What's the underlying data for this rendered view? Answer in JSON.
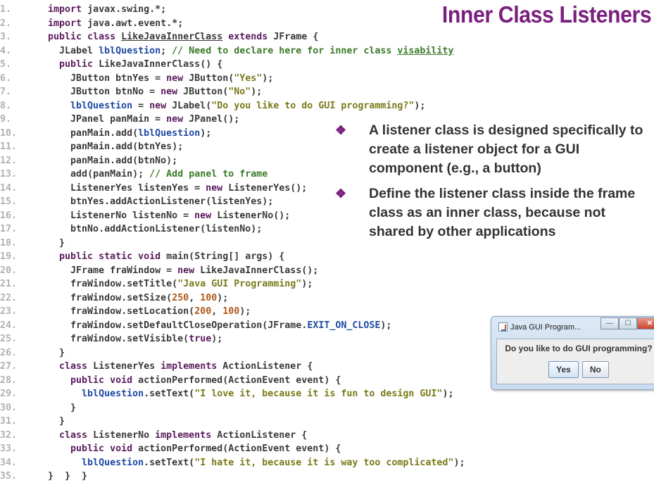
{
  "title": "Inner Class Listeners",
  "code_lines": [
    {
      "n": "1.",
      "indent": 1,
      "segs": [
        [
          "k",
          "import"
        ],
        [
          "p",
          " javax"
        ],
        [
          "o",
          "."
        ],
        [
          "p",
          "swing"
        ],
        [
          "o",
          ".*;"
        ]
      ]
    },
    {
      "n": "2.",
      "indent": 1,
      "segs": [
        [
          "k",
          "import"
        ],
        [
          "p",
          " java"
        ],
        [
          "o",
          "."
        ],
        [
          "p",
          "awt"
        ],
        [
          "o",
          "."
        ],
        [
          "p",
          "event"
        ],
        [
          "o",
          ".*;"
        ]
      ]
    },
    {
      "n": "3.",
      "indent": 1,
      "segs": [
        [
          "k",
          "public class "
        ],
        [
          "pu",
          "LikeJavaInnerClass"
        ],
        [
          "k",
          " extends "
        ],
        [
          "p",
          "JFrame "
        ],
        [
          "o",
          "{"
        ]
      ]
    },
    {
      "n": "4.",
      "indent": 2,
      "segs": [
        [
          "p",
          "JLabel "
        ],
        [
          "f",
          "lblQuestion"
        ],
        [
          "o",
          "; "
        ],
        [
          "c",
          "// Need to declare here for inner class "
        ],
        [
          "cu",
          "visability"
        ]
      ]
    },
    {
      "n": "5.",
      "indent": 2,
      "segs": [
        [
          "k",
          "public "
        ],
        [
          "p",
          "LikeJavaInnerClass"
        ],
        [
          "o",
          "() {"
        ]
      ]
    },
    {
      "n": "6.",
      "indent": 3,
      "segs": [
        [
          "p",
          "JButton btnYes "
        ],
        [
          "o",
          "= "
        ],
        [
          "k",
          "new "
        ],
        [
          "p",
          "JButton"
        ],
        [
          "o",
          "("
        ],
        [
          "s",
          "\"Yes\""
        ],
        [
          "o",
          ");"
        ]
      ]
    },
    {
      "n": "7.",
      "indent": 3,
      "segs": [
        [
          "p",
          "JButton btnNo "
        ],
        [
          "o",
          "= "
        ],
        [
          "k",
          "new "
        ],
        [
          "p",
          "JButton"
        ],
        [
          "o",
          "("
        ],
        [
          "s",
          "\"No\""
        ],
        [
          "o",
          ");"
        ]
      ]
    },
    {
      "n": "8.",
      "indent": 3,
      "segs": [
        [
          "f",
          "lblQuestion "
        ],
        [
          "o",
          "= "
        ],
        [
          "k",
          "new "
        ],
        [
          "p",
          "JLabel"
        ],
        [
          "o",
          "("
        ],
        [
          "s",
          "\"Do you like to do GUI programming?\""
        ],
        [
          "o",
          ");"
        ]
      ]
    },
    {
      "n": "9.",
      "indent": 3,
      "segs": [
        [
          "p",
          "JPanel panMain "
        ],
        [
          "o",
          "= "
        ],
        [
          "k",
          "new "
        ],
        [
          "p",
          "JPanel"
        ],
        [
          "o",
          "();"
        ]
      ]
    },
    {
      "n": "10.",
      "indent": 3,
      "segs": [
        [
          "p",
          "panMain"
        ],
        [
          "o",
          "."
        ],
        [
          "p",
          "add"
        ],
        [
          "o",
          "("
        ],
        [
          "f",
          "lblQuestion"
        ],
        [
          "o",
          ");"
        ]
      ]
    },
    {
      "n": "11.",
      "indent": 3,
      "segs": [
        [
          "p",
          "panMain"
        ],
        [
          "o",
          "."
        ],
        [
          "p",
          "add"
        ],
        [
          "o",
          "("
        ],
        [
          "p",
          "btnYes"
        ],
        [
          "o",
          ");"
        ]
      ]
    },
    {
      "n": "12.",
      "indent": 3,
      "segs": [
        [
          "p",
          "panMain"
        ],
        [
          "o",
          "."
        ],
        [
          "p",
          "add"
        ],
        [
          "o",
          "("
        ],
        [
          "p",
          "btnNo"
        ],
        [
          "o",
          ");"
        ]
      ]
    },
    {
      "n": "13.",
      "indent": 3,
      "segs": [
        [
          "p",
          "add"
        ],
        [
          "o",
          "("
        ],
        [
          "p",
          "panMain"
        ],
        [
          "o",
          "); "
        ],
        [
          "c",
          "// Add panel to frame"
        ]
      ]
    },
    {
      "n": "14.",
      "indent": 3,
      "segs": [
        [
          "p",
          "ListenerYes listenYes "
        ],
        [
          "o",
          "= "
        ],
        [
          "k",
          "new "
        ],
        [
          "p",
          "ListenerYes"
        ],
        [
          "o",
          "();"
        ]
      ]
    },
    {
      "n": "15.",
      "indent": 3,
      "segs": [
        [
          "p",
          "btnYes"
        ],
        [
          "o",
          "."
        ],
        [
          "p",
          "addActionListener"
        ],
        [
          "o",
          "("
        ],
        [
          "p",
          "listenYes"
        ],
        [
          "o",
          ");"
        ]
      ]
    },
    {
      "n": "16.",
      "indent": 3,
      "segs": [
        [
          "p",
          "ListenerNo listenNo "
        ],
        [
          "o",
          "= "
        ],
        [
          "k",
          "new "
        ],
        [
          "p",
          "ListenerNo"
        ],
        [
          "o",
          "();"
        ]
      ]
    },
    {
      "n": "17.",
      "indent": 3,
      "segs": [
        [
          "p",
          "btnNo"
        ],
        [
          "o",
          "."
        ],
        [
          "p",
          "addActionListener"
        ],
        [
          "o",
          "("
        ],
        [
          "p",
          "listenNo"
        ],
        [
          "o",
          ");"
        ]
      ]
    },
    {
      "n": "18.",
      "indent": 2,
      "segs": [
        [
          "o",
          "}"
        ]
      ]
    },
    {
      "n": "19.",
      "indent": 2,
      "segs": [
        [
          "k",
          "public static void "
        ],
        [
          "p",
          "main"
        ],
        [
          "o",
          "("
        ],
        [
          "p",
          "String"
        ],
        [
          "o",
          "[] "
        ],
        [
          "p",
          "args"
        ],
        [
          "o",
          ") {"
        ]
      ]
    },
    {
      "n": "20.",
      "indent": 3,
      "segs": [
        [
          "p",
          "JFrame fraWindow "
        ],
        [
          "o",
          "= "
        ],
        [
          "k",
          "new "
        ],
        [
          "p",
          "LikeJavaInnerClass"
        ],
        [
          "o",
          "();"
        ]
      ]
    },
    {
      "n": "21.",
      "indent": 3,
      "segs": [
        [
          "p",
          "fraWindow"
        ],
        [
          "o",
          "."
        ],
        [
          "p",
          "setTitle"
        ],
        [
          "o",
          "("
        ],
        [
          "s",
          "\"Java GUI Programming\""
        ],
        [
          "o",
          ");"
        ]
      ]
    },
    {
      "n": "22.",
      "indent": 3,
      "segs": [
        [
          "p",
          "fraWindow"
        ],
        [
          "o",
          "."
        ],
        [
          "p",
          "setSize"
        ],
        [
          "o",
          "("
        ],
        [
          "n",
          "250"
        ],
        [
          "o",
          ", "
        ],
        [
          "n",
          "100"
        ],
        [
          "o",
          ");"
        ]
      ]
    },
    {
      "n": "23.",
      "indent": 3,
      "segs": [
        [
          "p",
          "fraWindow"
        ],
        [
          "o",
          "."
        ],
        [
          "p",
          "setLocation"
        ],
        [
          "o",
          "("
        ],
        [
          "n",
          "200"
        ],
        [
          "o",
          ", "
        ],
        [
          "n",
          "100"
        ],
        [
          "o",
          ");"
        ]
      ]
    },
    {
      "n": "24.",
      "indent": 3,
      "segs": [
        [
          "p",
          "fraWindow"
        ],
        [
          "o",
          "."
        ],
        [
          "p",
          "setDefaultCloseOperation"
        ],
        [
          "o",
          "("
        ],
        [
          "p",
          "JFrame"
        ],
        [
          "o",
          "."
        ],
        [
          "f",
          "EXIT_ON_CLOSE"
        ],
        [
          "o",
          ");"
        ]
      ]
    },
    {
      "n": "25.",
      "indent": 3,
      "segs": [
        [
          "p",
          "fraWindow"
        ],
        [
          "o",
          "."
        ],
        [
          "p",
          "setVisible"
        ],
        [
          "o",
          "("
        ],
        [
          "k",
          "true"
        ],
        [
          "o",
          ");"
        ]
      ]
    },
    {
      "n": "26.",
      "indent": 2,
      "segs": [
        [
          "o",
          "}"
        ]
      ]
    },
    {
      "n": "27.",
      "indent": 2,
      "segs": [
        [
          "k",
          "class "
        ],
        [
          "p",
          "ListenerYes "
        ],
        [
          "k",
          "implements "
        ],
        [
          "p",
          "ActionListener "
        ],
        [
          "o",
          "{"
        ]
      ]
    },
    {
      "n": "28.",
      "indent": 3,
      "segs": [
        [
          "k",
          "public void "
        ],
        [
          "p",
          "actionPerformed"
        ],
        [
          "o",
          "("
        ],
        [
          "p",
          "ActionEvent event"
        ],
        [
          "o",
          ") {"
        ]
      ]
    },
    {
      "n": "29.",
      "indent": 4,
      "segs": [
        [
          "f",
          "lblQuestion"
        ],
        [
          "o",
          "."
        ],
        [
          "p",
          "setText"
        ],
        [
          "o",
          "("
        ],
        [
          "s",
          "\"I love it, because it is fun to design GUI\""
        ],
        [
          "o",
          ");"
        ]
      ]
    },
    {
      "n": "30.",
      "indent": 3,
      "segs": [
        [
          "o",
          "}"
        ]
      ]
    },
    {
      "n": "31.",
      "indent": 2,
      "segs": [
        [
          "o",
          "}"
        ]
      ]
    },
    {
      "n": "32.",
      "indent": 2,
      "segs": [
        [
          "k",
          "class "
        ],
        [
          "p",
          "ListenerNo "
        ],
        [
          "k",
          "implements "
        ],
        [
          "p",
          "ActionListener "
        ],
        [
          "o",
          "{"
        ]
      ]
    },
    {
      "n": "33.",
      "indent": 3,
      "segs": [
        [
          "k",
          "public void "
        ],
        [
          "p",
          "actionPerformed"
        ],
        [
          "o",
          "("
        ],
        [
          "p",
          "ActionEvent event"
        ],
        [
          "o",
          ") {"
        ]
      ]
    },
    {
      "n": "34.",
      "indent": 4,
      "segs": [
        [
          "f",
          "lblQuestion"
        ],
        [
          "o",
          "."
        ],
        [
          "p",
          "setText"
        ],
        [
          "o",
          "("
        ],
        [
          "s",
          "\"I hate it, because it is way too complicated\""
        ],
        [
          "o",
          ");"
        ]
      ]
    },
    {
      "n": "35.",
      "indent": 1,
      "segs": [
        [
          "o",
          "}  }  }"
        ]
      ]
    }
  ],
  "bullets": [
    "A listener class is designed specifically to create a listener object for a GUI component (e.g., a button)",
    "Define the listener class inside the frame class as an inner class, because not shared by other applications"
  ],
  "bullet_symbol": "❖",
  "window": {
    "title": "Java GUI Program...",
    "icon": "java-cup-icon",
    "minimize": "—",
    "maximize": "☐",
    "close": "✕",
    "label": "Do you like to do GUI programming?",
    "yes": "Yes",
    "no": "No"
  },
  "colors": {
    "title": "#7a1f7e",
    "keyword": "#5a1b5e",
    "string": "#7a7a1a",
    "comment": "#3c7a2a",
    "number": "#b0571a",
    "field": "#1f4aa3",
    "line_number": "#b0b0b0"
  }
}
